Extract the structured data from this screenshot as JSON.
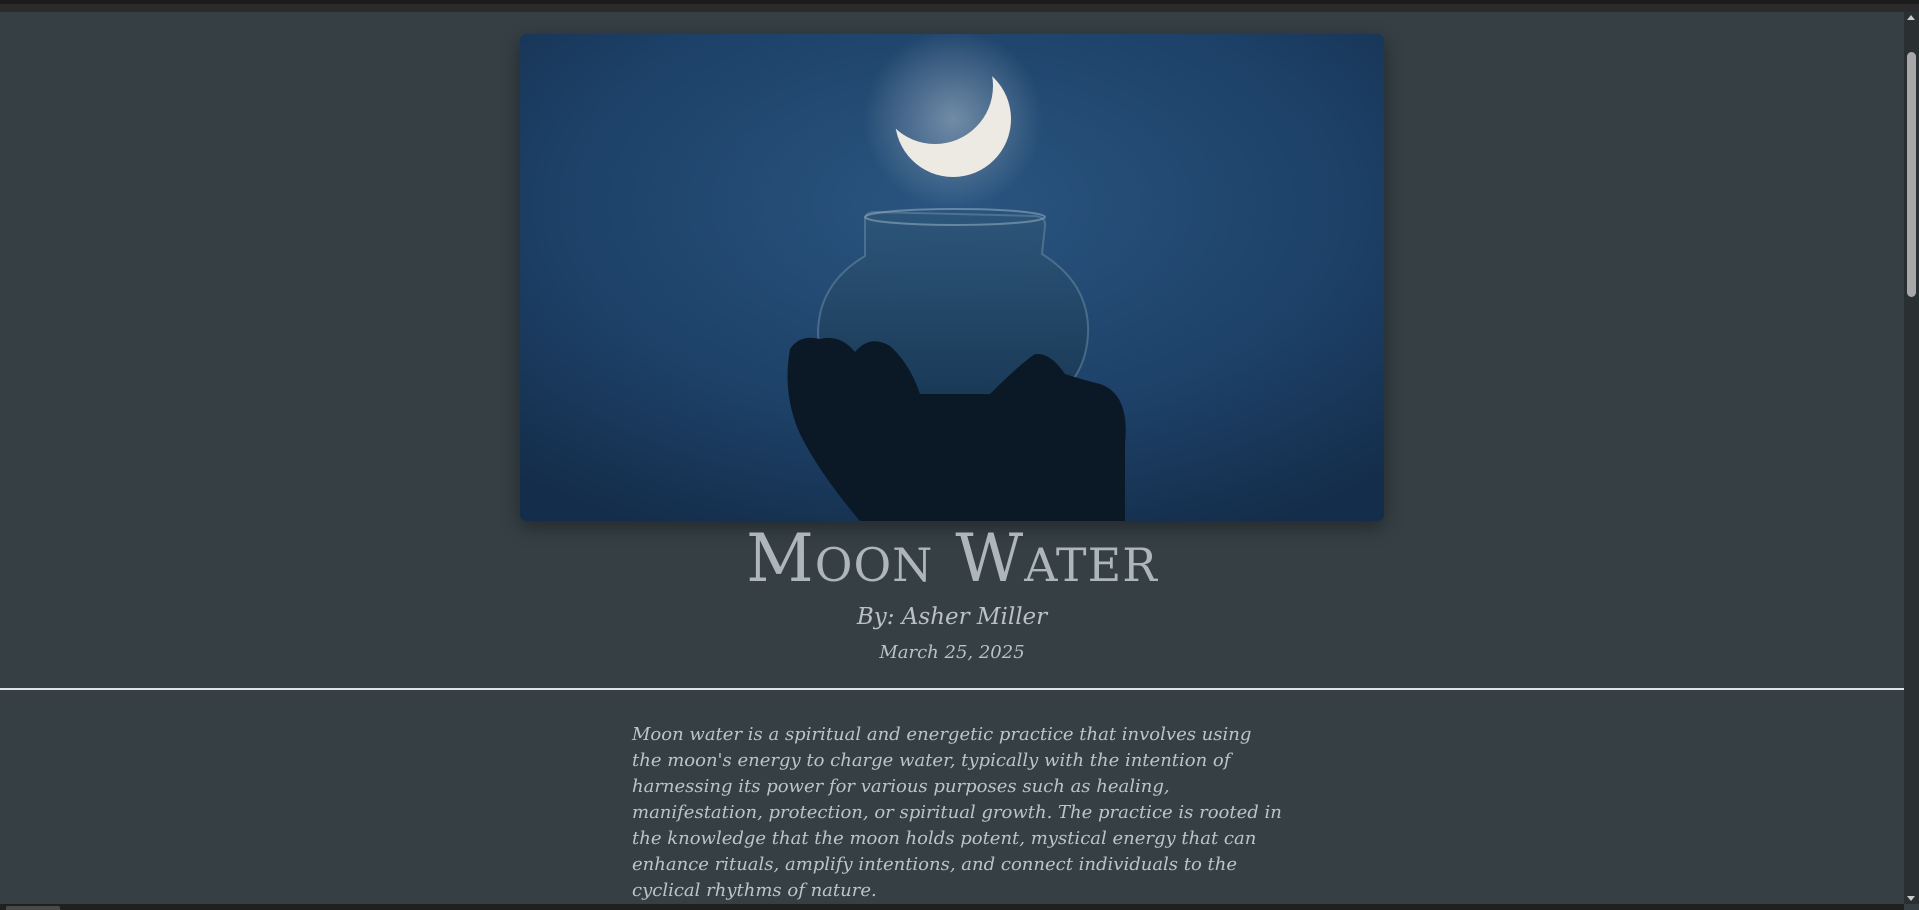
{
  "article": {
    "title": "Moon Water",
    "byline": "By: Asher Miller",
    "date": "March 25, 2025",
    "hero_alt": "Hand holding a glass jar under a crescent moon",
    "paragraphs": [
      "Moon water is a spiritual and energetic practice that involves using the moon's energy to charge water, typically with the intention of harnessing its power for various purposes such as healing, manifestation, protection, or spiritual growth. The practice is rooted in the knowledge that the moon holds potent, mystical energy that can enhance rituals, amplify intentions, and connect individuals to the cyclical rhythms of nature."
    ]
  },
  "colors": {
    "background": "#353f44",
    "text": "#b9c1c6",
    "divider": "#dfe4e6",
    "hero_sky": "#1b3a5a"
  },
  "icons": {
    "scroll_up": "triangle-up",
    "scroll_down": "triangle-down"
  }
}
